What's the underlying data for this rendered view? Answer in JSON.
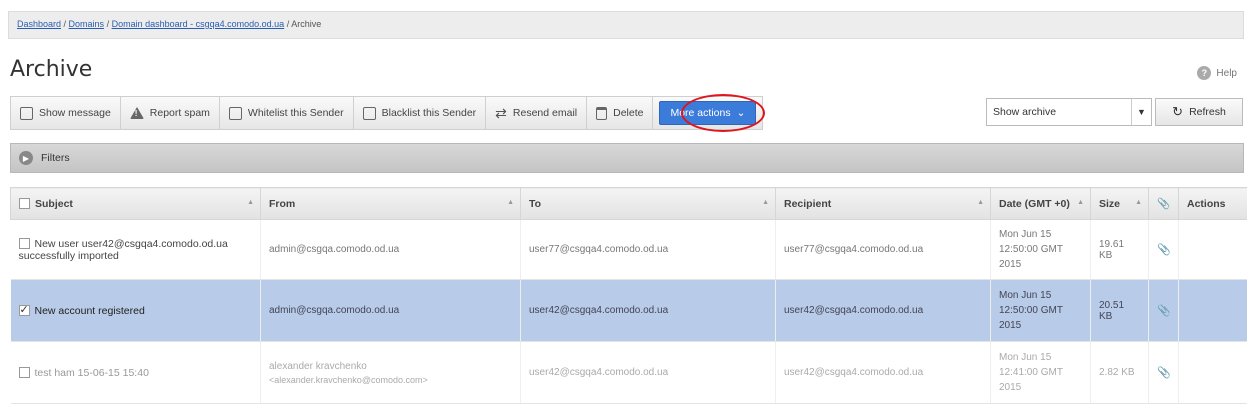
{
  "breadcrumb": {
    "dashboard": "Dashboard",
    "sep1": " / ",
    "domains": "Domains",
    "sep2": " / ",
    "domain_dashboard": "Domain dashboard - csgqa4.comodo.od.ua",
    "sep3": " / ",
    "current": "Archive"
  },
  "page_title": "Archive",
  "help_label": "Help",
  "toolbar": {
    "show_message": "Show message",
    "report_spam": "Report spam",
    "whitelist": "Whitelist this Sender",
    "blacklist": "Blacklist this Sender",
    "resend": "Resend email",
    "delete": "Delete",
    "more_actions": "More actions"
  },
  "archive_select": {
    "value": "Show archive"
  },
  "refresh_label": "Refresh",
  "filters_label": "Filters",
  "table": {
    "headers": {
      "subject": "Subject",
      "from": "From",
      "to": "To",
      "recipient": "Recipient",
      "date": "Date (GMT +0)",
      "size": "Size",
      "actions": "Actions"
    },
    "rows": [
      {
        "subject": "New user user42@csgqa4.comodo.od.ua successfully imported",
        "from": "admin@csgqa.comodo.od.ua",
        "from_sub": "",
        "to": "user77@csgqa4.comodo.od.ua",
        "recipient": "user77@csgqa4.comodo.od.ua",
        "date": "Mon Jun 15 12:50:00 GMT 2015",
        "size": "19.61 KB"
      },
      {
        "subject": "New account registered",
        "from": "admin@csgqa.comodo.od.ua",
        "from_sub": "",
        "to": "user42@csgqa4.comodo.od.ua",
        "recipient": "user42@csgqa4.comodo.od.ua",
        "date": "Mon Jun 15 12:50:00 GMT 2015",
        "size": "20.51 KB"
      },
      {
        "subject": "test ham 15-06-15 15:40",
        "from": "alexander kravchenko",
        "from_sub": "<alexander.kravchenko@comodo.com>",
        "to": "user42@csgqa4.comodo.od.ua",
        "recipient": "user42@csgqa4.comodo.od.ua",
        "date": "Mon Jun 15 12:41:00 GMT 2015",
        "size": "2.82 KB"
      }
    ]
  }
}
